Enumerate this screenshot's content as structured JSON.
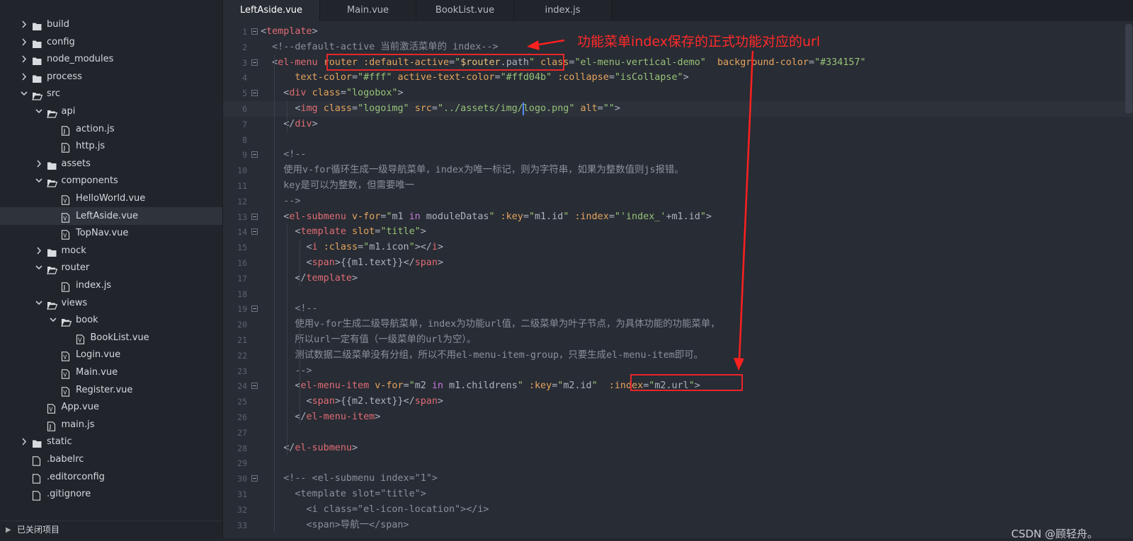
{
  "sidebar": {
    "items": [
      {
        "label": "build",
        "kind": "folder",
        "depth": 0,
        "open": false
      },
      {
        "label": "config",
        "kind": "folder",
        "depth": 0,
        "open": false
      },
      {
        "label": "node_modules",
        "kind": "folder",
        "depth": 0,
        "open": false
      },
      {
        "label": "process",
        "kind": "folder",
        "depth": 0,
        "open": false
      },
      {
        "label": "src",
        "kind": "folder",
        "depth": 0,
        "open": true
      },
      {
        "label": "api",
        "kind": "folder",
        "depth": 1,
        "open": true
      },
      {
        "label": "action.js",
        "kind": "file",
        "depth": 2
      },
      {
        "label": "http.js",
        "kind": "file",
        "depth": 2
      },
      {
        "label": "assets",
        "kind": "folder",
        "depth": 1,
        "open": false
      },
      {
        "label": "components",
        "kind": "folder",
        "depth": 1,
        "open": true
      },
      {
        "label": "HelloWorld.vue",
        "kind": "file",
        "depth": 2
      },
      {
        "label": "LeftAside.vue",
        "kind": "file",
        "depth": 2,
        "selected": true
      },
      {
        "label": "TopNav.vue",
        "kind": "file",
        "depth": 2
      },
      {
        "label": "mock",
        "kind": "folder",
        "depth": 1,
        "open": false
      },
      {
        "label": "router",
        "kind": "folder",
        "depth": 1,
        "open": true
      },
      {
        "label": "index.js",
        "kind": "file",
        "depth": 2
      },
      {
        "label": "views",
        "kind": "folder",
        "depth": 1,
        "open": true
      },
      {
        "label": "book",
        "kind": "folder",
        "depth": 2,
        "open": true
      },
      {
        "label": "BookList.vue",
        "kind": "file",
        "depth": 3
      },
      {
        "label": "Login.vue",
        "kind": "file",
        "depth": 2
      },
      {
        "label": "Main.vue",
        "kind": "file",
        "depth": 2
      },
      {
        "label": "Register.vue",
        "kind": "file",
        "depth": 2
      },
      {
        "label": "App.vue",
        "kind": "file",
        "depth": 1
      },
      {
        "label": "main.js",
        "kind": "file",
        "depth": 1
      },
      {
        "label": "static",
        "kind": "folder",
        "depth": 0,
        "open": false
      },
      {
        "label": ".babelrc",
        "kind": "file",
        "depth": 0
      },
      {
        "label": ".editorconfig",
        "kind": "file",
        "depth": 0
      },
      {
        "label": ".gitignore",
        "kind": "file",
        "depth": 0
      }
    ],
    "footer_label": "已关闭项目"
  },
  "tabs": [
    {
      "label": "LeftAside.vue",
      "active": true
    },
    {
      "label": "Main.vue",
      "active": false
    },
    {
      "label": "BookList.vue",
      "active": false
    },
    {
      "label": "index.js",
      "active": false
    }
  ],
  "code": {
    "lines": [
      {
        "n": "1",
        "fold": true,
        "segs": [
          [
            "<",
            "pu"
          ],
          [
            "template",
            "tag"
          ],
          [
            ">",
            "pu"
          ]
        ]
      },
      {
        "n": "2",
        "segs": [
          [
            "  <!--default-active 当前激活菜单的 index-->",
            "cm"
          ]
        ]
      },
      {
        "n": "3",
        "fold": true,
        "segs": [
          [
            "  <",
            "pu"
          ],
          [
            "el-menu",
            "tag"
          ],
          [
            " ",
            "pl"
          ],
          [
            "router",
            "attr"
          ],
          [
            " ",
            "pl"
          ],
          [
            ":default-active",
            "attr"
          ],
          [
            "=",
            "pu"
          ],
          [
            "\"",
            "str"
          ],
          [
            "$router",
            "ex"
          ],
          [
            ".",
            "pu"
          ],
          [
            "path",
            "pl"
          ],
          [
            "\"",
            "str"
          ],
          [
            " ",
            "pl"
          ],
          [
            "class",
            "attr"
          ],
          [
            "=",
            "pu"
          ],
          [
            "\"el-menu-vertical-demo\"",
            "str"
          ],
          [
            "  ",
            "pl"
          ],
          [
            "background-color",
            "attr"
          ],
          [
            "=",
            "pu"
          ],
          [
            "\"#334157\"",
            "str"
          ]
        ]
      },
      {
        "n": "4",
        "segs": [
          [
            "      ",
            "pl"
          ],
          [
            "text-color",
            "attr"
          ],
          [
            "=",
            "pu"
          ],
          [
            "\"#fff\"",
            "str"
          ],
          [
            " ",
            "pl"
          ],
          [
            "active-text-color",
            "attr"
          ],
          [
            "=",
            "pu"
          ],
          [
            "\"#ffd04b\"",
            "str"
          ],
          [
            " ",
            "pl"
          ],
          [
            ":collapse",
            "attr"
          ],
          [
            "=",
            "pu"
          ],
          [
            "\"isCollapse\"",
            "str"
          ],
          [
            ">",
            "pu"
          ]
        ]
      },
      {
        "n": "5",
        "fold": true,
        "segs": [
          [
            "    <",
            "pu"
          ],
          [
            "div",
            "tag"
          ],
          [
            " ",
            "pl"
          ],
          [
            "class",
            "attr"
          ],
          [
            "=",
            "pu"
          ],
          [
            "\"logobox\"",
            "str"
          ],
          [
            ">",
            "pu"
          ]
        ]
      },
      {
        "n": "6",
        "cur": true,
        "segs": [
          [
            "      <",
            "pu"
          ],
          [
            "img",
            "tag"
          ],
          [
            " ",
            "pl"
          ],
          [
            "class",
            "attr"
          ],
          [
            "=",
            "pu"
          ],
          [
            "\"logoimg\"",
            "str"
          ],
          [
            " ",
            "pl"
          ],
          [
            "src",
            "attr"
          ],
          [
            "=",
            "pu"
          ],
          [
            "\"../assets/img/logo.png\"",
            "str"
          ],
          [
            " ",
            "pl"
          ],
          [
            "alt",
            "attr"
          ],
          [
            "=",
            "pu"
          ],
          [
            "\"\"",
            "str"
          ],
          [
            ">",
            "pu"
          ]
        ]
      },
      {
        "n": "7",
        "segs": [
          [
            "    </",
            "pu"
          ],
          [
            "div",
            "tag"
          ],
          [
            ">",
            "pu"
          ]
        ]
      },
      {
        "n": "8",
        "segs": []
      },
      {
        "n": "9",
        "fold": true,
        "segs": [
          [
            "    <!--",
            "cm"
          ]
        ]
      },
      {
        "n": "10",
        "segs": [
          [
            "    使用v-for循环生成一级导航菜单，index为唯一标记，则为字符串，如果为整数值则js报错。",
            "cm"
          ]
        ]
      },
      {
        "n": "11",
        "segs": [
          [
            "    key是可以为整数，但需要唯一",
            "cm"
          ]
        ]
      },
      {
        "n": "12",
        "segs": [
          [
            "    -->",
            "cm"
          ]
        ]
      },
      {
        "n": "13",
        "fold": true,
        "segs": [
          [
            "    <",
            "pu"
          ],
          [
            "el-submenu",
            "tag"
          ],
          [
            " ",
            "pl"
          ],
          [
            "v-for",
            "attr"
          ],
          [
            "=",
            "pu"
          ],
          [
            "\"",
            "str"
          ],
          [
            "m1 ",
            "pl"
          ],
          [
            "in",
            "kw"
          ],
          [
            " moduleDatas",
            "pl"
          ],
          [
            "\"",
            "str"
          ],
          [
            " ",
            "pl"
          ],
          [
            ":key",
            "attr"
          ],
          [
            "=",
            "pu"
          ],
          [
            "\"",
            "str"
          ],
          [
            "m1",
            "pl"
          ],
          [
            ".",
            "pu"
          ],
          [
            "id",
            "pl"
          ],
          [
            "\"",
            "str"
          ],
          [
            " ",
            "pl"
          ],
          [
            ":index",
            "attr"
          ],
          [
            "=",
            "pu"
          ],
          [
            "\"",
            "str"
          ],
          [
            "'index_'",
            "str"
          ],
          [
            "+",
            "pu"
          ],
          [
            "m1",
            "pl"
          ],
          [
            ".",
            "pu"
          ],
          [
            "id",
            "pl"
          ],
          [
            "\"",
            "str"
          ],
          [
            ">",
            "pu"
          ]
        ]
      },
      {
        "n": "14",
        "fold": true,
        "segs": [
          [
            "      <",
            "pu"
          ],
          [
            "template",
            "tag"
          ],
          [
            " ",
            "pl"
          ],
          [
            "slot",
            "attr"
          ],
          [
            "=",
            "pu"
          ],
          [
            "\"title\"",
            "str"
          ],
          [
            ">",
            "pu"
          ]
        ]
      },
      {
        "n": "15",
        "segs": [
          [
            "        <",
            "pu"
          ],
          [
            "i",
            "tag"
          ],
          [
            " ",
            "pl"
          ],
          [
            ":class",
            "attr"
          ],
          [
            "=",
            "pu"
          ],
          [
            "\"",
            "str"
          ],
          [
            "m1",
            "pl"
          ],
          [
            ".",
            "pu"
          ],
          [
            "icon",
            "pl"
          ],
          [
            "\"",
            "str"
          ],
          [
            "></",
            "pu"
          ],
          [
            "i",
            "tag"
          ],
          [
            ">",
            "pu"
          ]
        ]
      },
      {
        "n": "16",
        "segs": [
          [
            "        <",
            "pu"
          ],
          [
            "span",
            "tag"
          ],
          [
            ">",
            "pu"
          ],
          [
            "{{",
            "pl"
          ],
          [
            "m1",
            "pl"
          ],
          [
            ".",
            "pu"
          ],
          [
            "text",
            "pl"
          ],
          [
            "}}",
            "pl"
          ],
          [
            "</",
            "pu"
          ],
          [
            "span",
            "tag"
          ],
          [
            ">",
            "pu"
          ]
        ]
      },
      {
        "n": "17",
        "segs": [
          [
            "      </",
            "pu"
          ],
          [
            "template",
            "tag"
          ],
          [
            ">",
            "pu"
          ]
        ]
      },
      {
        "n": "18",
        "segs": []
      },
      {
        "n": "19",
        "fold": true,
        "segs": [
          [
            "      <!--",
            "cm"
          ]
        ]
      },
      {
        "n": "20",
        "segs": [
          [
            "      使用v-for生成二级导航菜单，index为功能url值，二级菜单为叶子节点，为具体功能的功能菜单，",
            "cm"
          ]
        ]
      },
      {
        "n": "21",
        "segs": [
          [
            "      所以url一定有值（一级菜单的url为空）。",
            "cm"
          ]
        ]
      },
      {
        "n": "22",
        "segs": [
          [
            "      测试数据二级菜单没有分组，所以不用el-menu-item-group，只要生成el-menu-item即可。",
            "cm"
          ]
        ]
      },
      {
        "n": "23",
        "segs": [
          [
            "      -->",
            "cm"
          ]
        ]
      },
      {
        "n": "24",
        "fold": true,
        "segs": [
          [
            "      <",
            "pu"
          ],
          [
            "el-menu-item",
            "tag"
          ],
          [
            " ",
            "pl"
          ],
          [
            "v-for",
            "attr"
          ],
          [
            "=",
            "pu"
          ],
          [
            "\"",
            "str"
          ],
          [
            "m2 ",
            "pl"
          ],
          [
            "in",
            "kw"
          ],
          [
            " m1",
            "pl"
          ],
          [
            ".",
            "pu"
          ],
          [
            "childrens",
            "pl"
          ],
          [
            "\"",
            "str"
          ],
          [
            " ",
            "pl"
          ],
          [
            ":key",
            "attr"
          ],
          [
            "=",
            "pu"
          ],
          [
            "\"",
            "str"
          ],
          [
            "m2",
            "pl"
          ],
          [
            ".",
            "pu"
          ],
          [
            "id",
            "pl"
          ],
          [
            "\"",
            "str"
          ],
          [
            "  ",
            "pl"
          ],
          [
            ":index",
            "attr"
          ],
          [
            "=",
            "pu"
          ],
          [
            "\"",
            "str"
          ],
          [
            "m2",
            "pl"
          ],
          [
            ".",
            "pu"
          ],
          [
            "url",
            "pl"
          ],
          [
            "\"",
            "str"
          ],
          [
            ">",
            "pu"
          ]
        ]
      },
      {
        "n": "25",
        "segs": [
          [
            "        <",
            "pu"
          ],
          [
            "span",
            "tag"
          ],
          [
            ">",
            "pu"
          ],
          [
            "{{",
            "pl"
          ],
          [
            "m2",
            "pl"
          ],
          [
            ".",
            "pu"
          ],
          [
            "text",
            "pl"
          ],
          [
            "}}",
            "pl"
          ],
          [
            "</",
            "pu"
          ],
          [
            "span",
            "tag"
          ],
          [
            ">",
            "pu"
          ]
        ]
      },
      {
        "n": "26",
        "segs": [
          [
            "      </",
            "pu"
          ],
          [
            "el-menu-item",
            "tag"
          ],
          [
            ">",
            "pu"
          ]
        ]
      },
      {
        "n": "27",
        "segs": []
      },
      {
        "n": "28",
        "segs": [
          [
            "    </",
            "pu"
          ],
          [
            "el-submenu",
            "tag"
          ],
          [
            ">",
            "pu"
          ]
        ]
      },
      {
        "n": "29",
        "segs": []
      },
      {
        "n": "30",
        "fold": true,
        "segs": [
          [
            "    <!-- <el-submenu index=\"1\">",
            "cm"
          ]
        ]
      },
      {
        "n": "31",
        "segs": [
          [
            "      <template slot=\"title\">",
            "cm"
          ]
        ]
      },
      {
        "n": "32",
        "segs": [
          [
            "        <i class=\"el-icon-location\"></i>",
            "cm"
          ]
        ]
      },
      {
        "n": "33",
        "segs": [
          [
            "        <span>导航一</span>",
            "cm"
          ]
        ]
      }
    ]
  },
  "annotation": {
    "text": "功能菜单index保存的正式功能对应的url",
    "color": "#ff2a2a"
  },
  "watermark": "CSDN @顾轻舟。",
  "colors": {
    "tag": "#e06c75",
    "attr": "#e5a55f",
    "string": "#98c379",
    "comment": "#8a919c",
    "keyword": "#c678dd",
    "plain": "#abb2bf",
    "highlight": "#e8262a"
  }
}
